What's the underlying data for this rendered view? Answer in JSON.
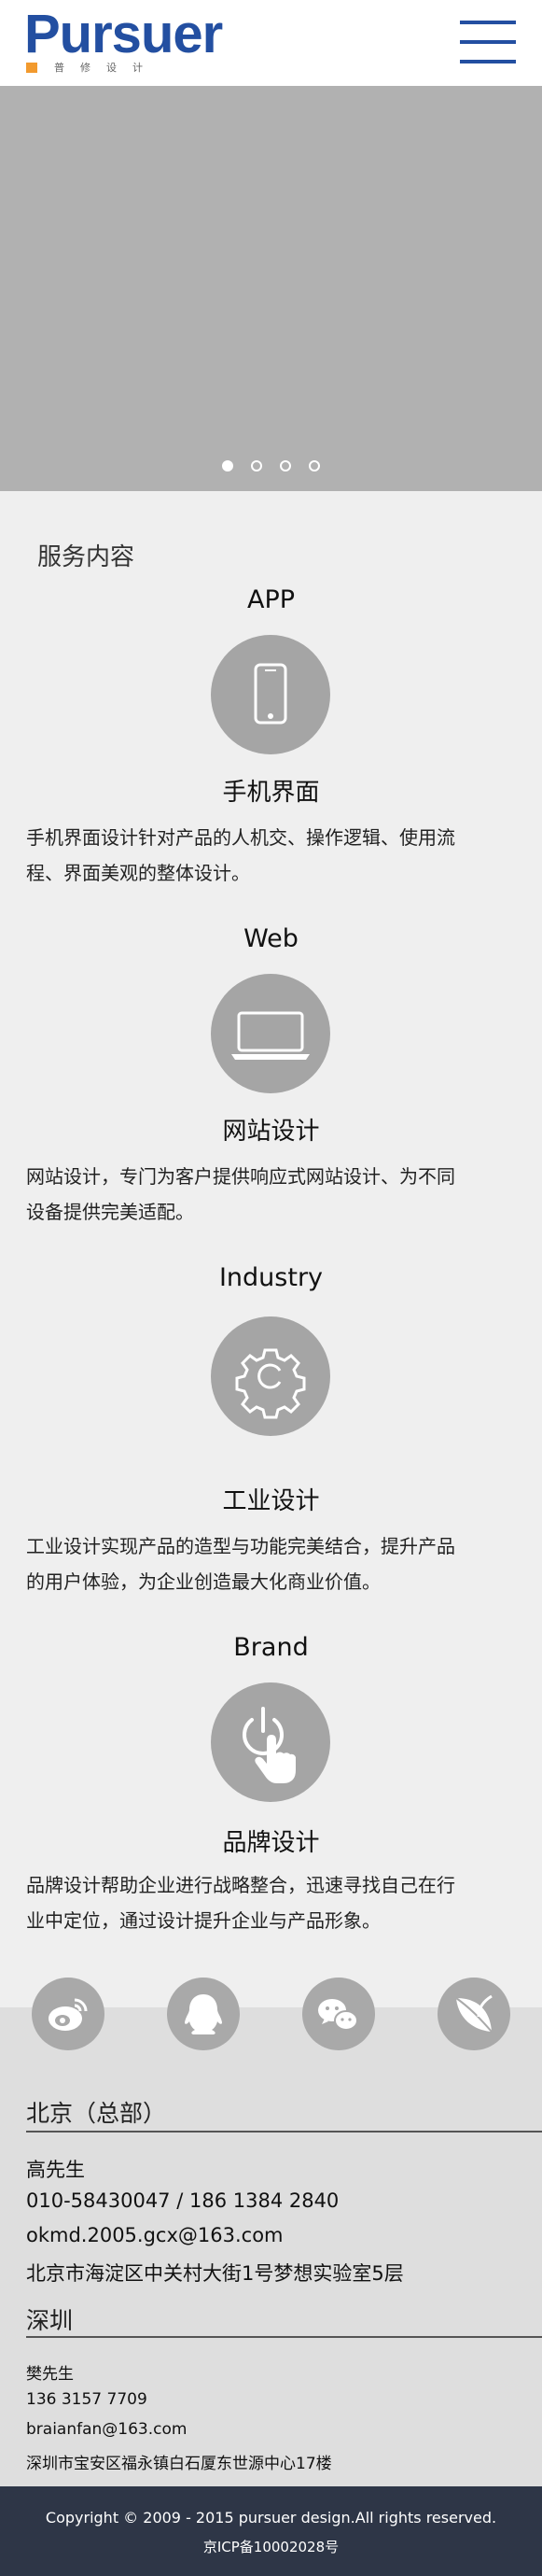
{
  "header": {
    "logo_text": "Pursuer",
    "logo_sub": "普修设计",
    "menu_icon": "hamburger-menu-icon",
    "brand_color": "#234fa1",
    "accent_color": "#f29a2e"
  },
  "carousel": {
    "slide_count": 4,
    "active_index": 0
  },
  "services": {
    "section_title": "服务内容",
    "items": [
      {
        "label": "APP",
        "icon": "smartphone-icon",
        "name": "手机界面",
        "desc_lines": [
          "手机界面设计针对产品的人机交、操作逻辑、使用流",
          "程、界面美观的整体设计。"
        ]
      },
      {
        "label": "Web",
        "icon": "laptop-icon",
        "name": "网站设计",
        "desc_lines": [
          "网站设计，专门为客户提供响应式网站设计、为不同",
          "设备提供完美适配。"
        ]
      },
      {
        "label": "Industry",
        "icon": "gear-icon",
        "name": "工业设计",
        "desc_lines": [
          "工业设计实现产品的造型与功能完美结合，提升产品",
          "的用户体验，为企业创造最大化商业价值。"
        ]
      },
      {
        "label": "Brand",
        "icon": "power-touch-icon",
        "name": "品牌设计",
        "desc_lines": [
          "品牌设计帮助企业进行战略整合，迅速寻找自己在行",
          "业中定位，通过设计提升企业与产品形象。"
        ]
      }
    ]
  },
  "social": [
    "weibo-icon",
    "qq-icon",
    "wechat-icon",
    "leaf-logo-icon"
  ],
  "contacts": {
    "beijing": {
      "city": "北京（总部）",
      "name": "高先生",
      "phone": "010-58430047 / 186 1384 2840",
      "email": "okmd.2005.gcx@163.com",
      "address": "北京市海淀区中关村大街1号梦想实验室5层"
    },
    "shenzhen": {
      "city": "深圳",
      "name": "樊先生",
      "phone": "136 3157 7709",
      "email": "braianfan@163.com",
      "address": "深圳市宝安区福永镇白石厦东世源中心17楼"
    }
  },
  "footer": {
    "copyright": "Copyright © 2009 - 2015 pursuer design.All rights reserved.",
    "icp": "京ICP备10002028号"
  }
}
